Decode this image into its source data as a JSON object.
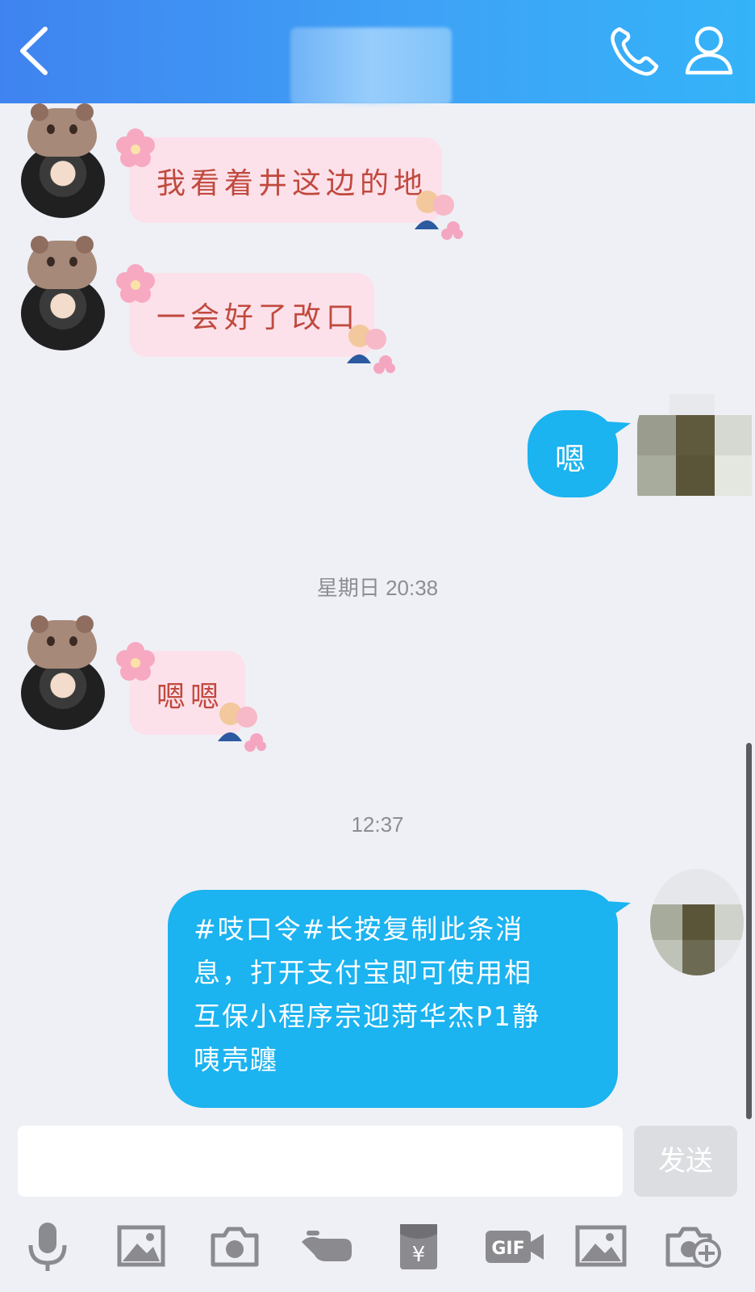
{
  "header": {
    "title": "",
    "back_icon": "back-chevron-icon",
    "call_icon": "phone-icon",
    "profile_icon": "person-icon",
    "gradient": [
      "#3f83f0",
      "#34b3f8"
    ]
  },
  "messages": [
    {
      "direction": "incoming",
      "text": "我看着井这边的地"
    },
    {
      "direction": "incoming",
      "text": "一会好了改口"
    },
    {
      "direction": "outgoing",
      "text": "嗯"
    },
    {
      "type": "timestamp",
      "text": "星期日 20:38"
    },
    {
      "direction": "incoming",
      "text": "嗯嗯"
    },
    {
      "type": "timestamp",
      "text": "12:37"
    },
    {
      "direction": "outgoing",
      "lines": [
        "#吱口令#长按复制此条消",
        "息，打开支付宝即可使用相",
        "互保小程序宗迎菏华杰P1静",
        "咦壳躔"
      ]
    }
  ],
  "input": {
    "value": "",
    "placeholder": ""
  },
  "send_label": "发送",
  "toolbar": {
    "voice_icon": "microphone-icon",
    "album_icon": "image-icon",
    "camera_icon": "camera-icon",
    "redpacket_text": "¥",
    "gif_text": "GIF",
    "photo_icon": "photo-icon",
    "more_icon": "camera-plus-icon"
  },
  "colors": {
    "outgoing_bubble": "#1bb3f0",
    "incoming_bubble": "#fce1ea",
    "incoming_text": "#c1493e",
    "background": "#eef0f5"
  }
}
